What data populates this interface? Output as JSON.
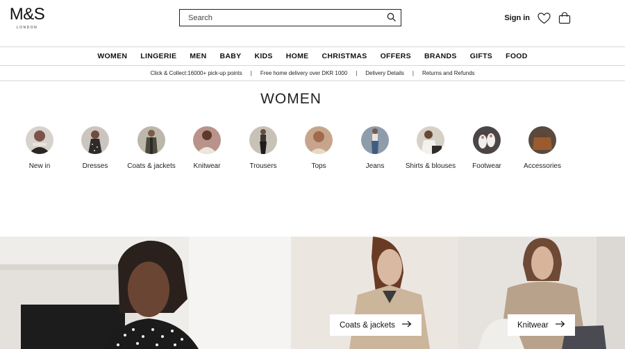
{
  "brand": {
    "name": "M&S",
    "sub": "LONDON"
  },
  "search": {
    "placeholder": "Search"
  },
  "header": {
    "signin": "Sign in"
  },
  "nav": [
    "WOMEN",
    "LINGERIE",
    "MEN",
    "BABY",
    "KIDS",
    "HOME",
    "CHRISTMAS",
    "OFFERS",
    "BRANDS",
    "GIFTS",
    "FOOD"
  ],
  "strip": [
    "Click & Collect:16000+ pick-up points",
    "Free home delivery over DKR 1000",
    "Delivery Details",
    "Returns and Refunds"
  ],
  "strip_separator": "|",
  "page_title": "WOMEN",
  "categories": [
    {
      "label": "New in",
      "color": "#7a5548"
    },
    {
      "label": "Dresses",
      "color": "#3d3a38"
    },
    {
      "label": "Coats & jackets",
      "color": "#6f6a5c"
    },
    {
      "label": "Knitwear",
      "color": "#8c6a55"
    },
    {
      "label": "Trousers",
      "color": "#5e5750"
    },
    {
      "label": "Tops",
      "color": "#a27257"
    },
    {
      "label": "Jeans",
      "color": "#6c7e91"
    },
    {
      "label": "Shirts & blouses",
      "color": "#b5a896"
    },
    {
      "label": "Footwear",
      "color": "#4b4645"
    },
    {
      "label": "Accessories",
      "color": "#8e5a33"
    }
  ],
  "banner": {
    "tags": [
      "Coats & jackets",
      "Knitwear"
    ]
  },
  "colors": {
    "border": "#d6d6d6",
    "text": "#111111"
  }
}
